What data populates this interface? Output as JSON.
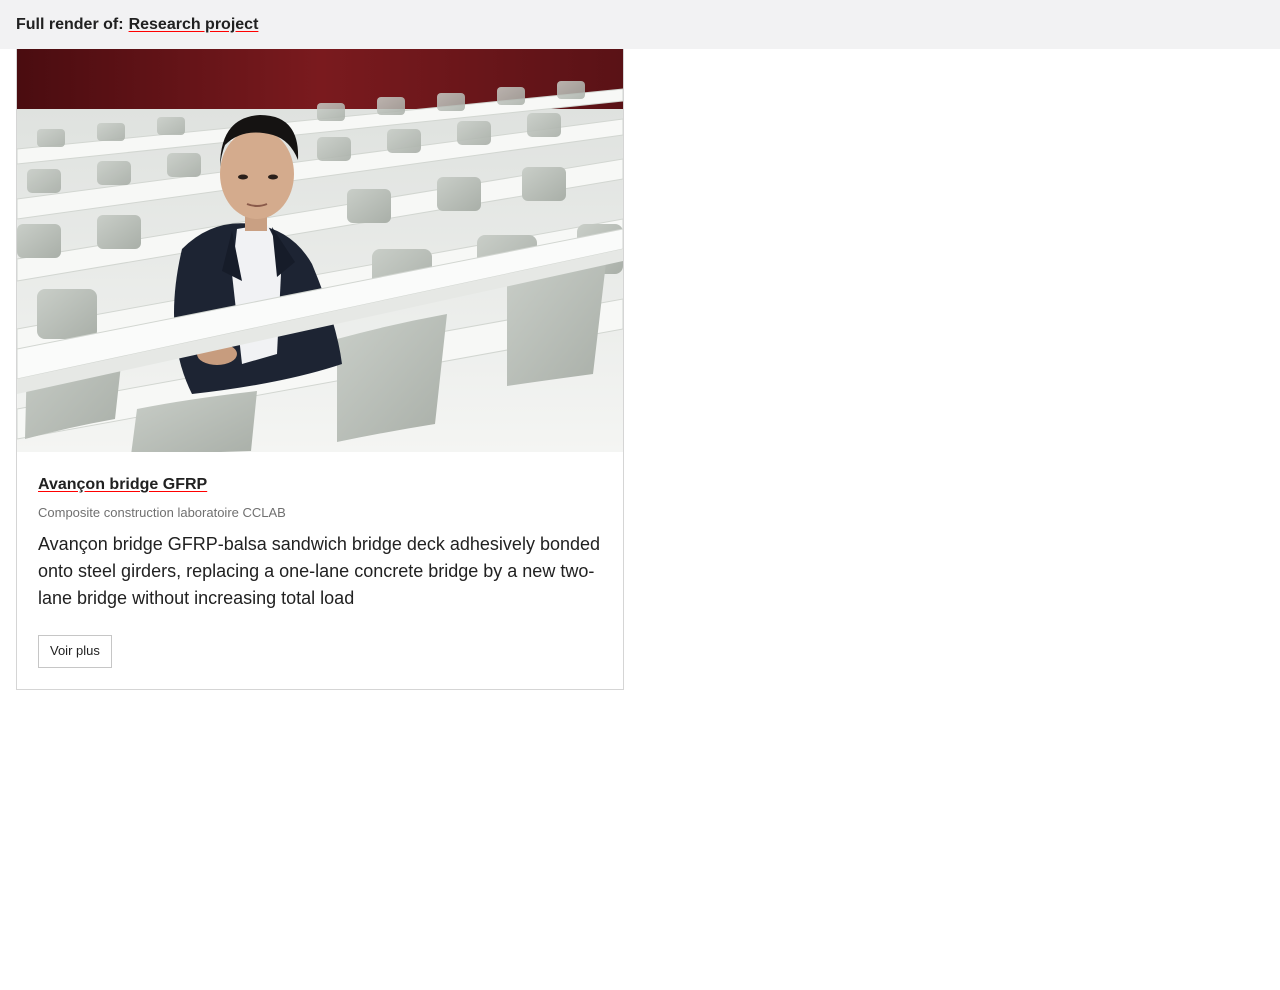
{
  "header": {
    "prefix": "Full render of:",
    "link_label": "Research project"
  },
  "card": {
    "image_icon": "photo-portrait",
    "title": "Avançon bridge GFRP",
    "subtitle": "Composite construction laboratoire CCLAB",
    "description": "Avançon bridge GFRP-balsa sandwich bridge deck adhesively bonded onto steel girders, replacing a one-lane concrete bridge by a new two-lane bridge without increasing total load",
    "button_label": "Voir plus"
  },
  "colors": {
    "link_underline": "#ff0000",
    "header_bg": "#f2f2f3",
    "card_border": "#d5d5d5",
    "photo_wall": "#6a1418"
  }
}
